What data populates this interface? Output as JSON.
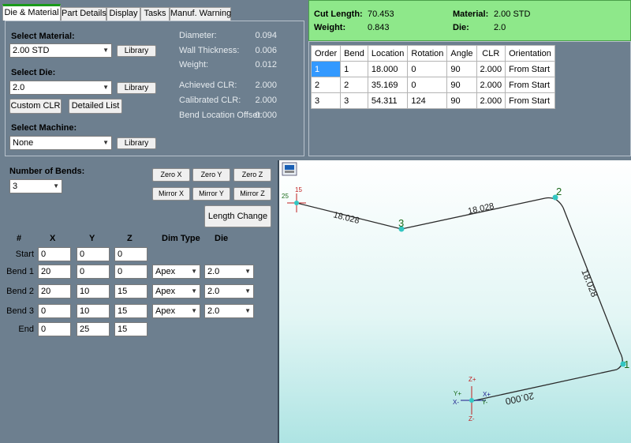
{
  "tabs": [
    "Die & Material",
    "Part Details",
    "Display",
    "Tasks",
    "Manuf. Warning"
  ],
  "material": {
    "select_material_label": "Select Material:",
    "material_value": "2.00 STD",
    "library_label": "Library",
    "select_die_label": "Select Die:",
    "die_value": "2.0",
    "custom_clr_label": "Custom CLR",
    "detailed_list_label": "Detailed List",
    "select_machine_label": "Select Machine:",
    "machine_value": "None"
  },
  "properties": [
    {
      "label": "Diameter:",
      "value": "0.094"
    },
    {
      "label": "Wall Thickness:",
      "value": "0.006"
    },
    {
      "label": "Weight:",
      "value": "0.012"
    },
    {
      "label": "Achieved CLR:",
      "value": "2.000"
    },
    {
      "label": "Calibrated CLR:",
      "value": "2.000"
    },
    {
      "label": "Bend Location Offset:",
      "value": "0.000"
    }
  ],
  "summary": {
    "cut_length_label": "Cut Length:",
    "cut_length": "70.453",
    "weight_label": "Weight:",
    "weight": "0.843",
    "material_label": "Material:",
    "material": "2.00 STD",
    "die_label": "Die:",
    "die": "2.0"
  },
  "bend_table": {
    "headers": [
      "Order",
      "Bend",
      "Location",
      "Rotation",
      "Angle",
      "CLR",
      "Orientation"
    ],
    "rows": [
      [
        "1",
        "1",
        "18.000",
        "0",
        "90",
        "2.000",
        "From Start"
      ],
      [
        "2",
        "2",
        "35.169",
        "0",
        "90",
        "2.000",
        "From Start"
      ],
      [
        "3",
        "3",
        "54.311",
        "124",
        "90",
        "2.000",
        "From Start"
      ]
    ]
  },
  "bends": {
    "number_label": "Number of Bends:",
    "number_value": "3",
    "buttons": [
      "Zero X",
      "Zero Y",
      "Zero Z",
      "Mirror X",
      "Mirror Y",
      "Mirror Z"
    ],
    "length_change_label": "Length Change",
    "col_headers": [
      "#",
      "X",
      "Y",
      "Z",
      "Dim Type",
      "Die"
    ],
    "rows": [
      {
        "label": "Start",
        "x": "0",
        "y": "0",
        "z": "0",
        "dim": "",
        "die": ""
      },
      {
        "label": "Bend 1",
        "x": "20",
        "y": "0",
        "z": "0",
        "dim": "Apex",
        "die": "2.0"
      },
      {
        "label": "Bend 2",
        "x": "20",
        "y": "10",
        "z": "15",
        "dim": "Apex",
        "die": "2.0"
      },
      {
        "label": "Bend 3",
        "x": "0",
        "y": "10",
        "z": "15",
        "dim": "Apex",
        "die": "2.0"
      },
      {
        "label": "End",
        "x": "0",
        "y": "25",
        "z": "15",
        "dim": "",
        "die": ""
      }
    ]
  },
  "viewport": {
    "segment_labels": [
      "20.000",
      "18.028",
      "18.028",
      "18.028"
    ],
    "bend_markers": [
      "1",
      "2",
      "3"
    ],
    "end_labels": [
      "25",
      "15"
    ],
    "axis_labels": [
      "Z+",
      "Z-",
      "Y+",
      "X-",
      "X+",
      "Y-"
    ]
  }
}
